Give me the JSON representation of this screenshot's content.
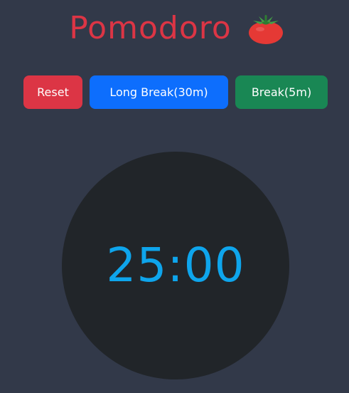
{
  "header": {
    "title": "Pomodoro",
    "icon": "tomato-icon"
  },
  "controls": {
    "reset_label": "Reset",
    "long_break_label": "Long Break(30m)",
    "break_label": "Break(5m)"
  },
  "timer": {
    "display": "25:00"
  },
  "colors": {
    "background": "#323949",
    "title": "#dc3545",
    "reset": "#dc3545",
    "long_break": "#0d6efd",
    "break": "#198754",
    "clock_face": "#212529",
    "time_text": "#0ea5ec"
  }
}
